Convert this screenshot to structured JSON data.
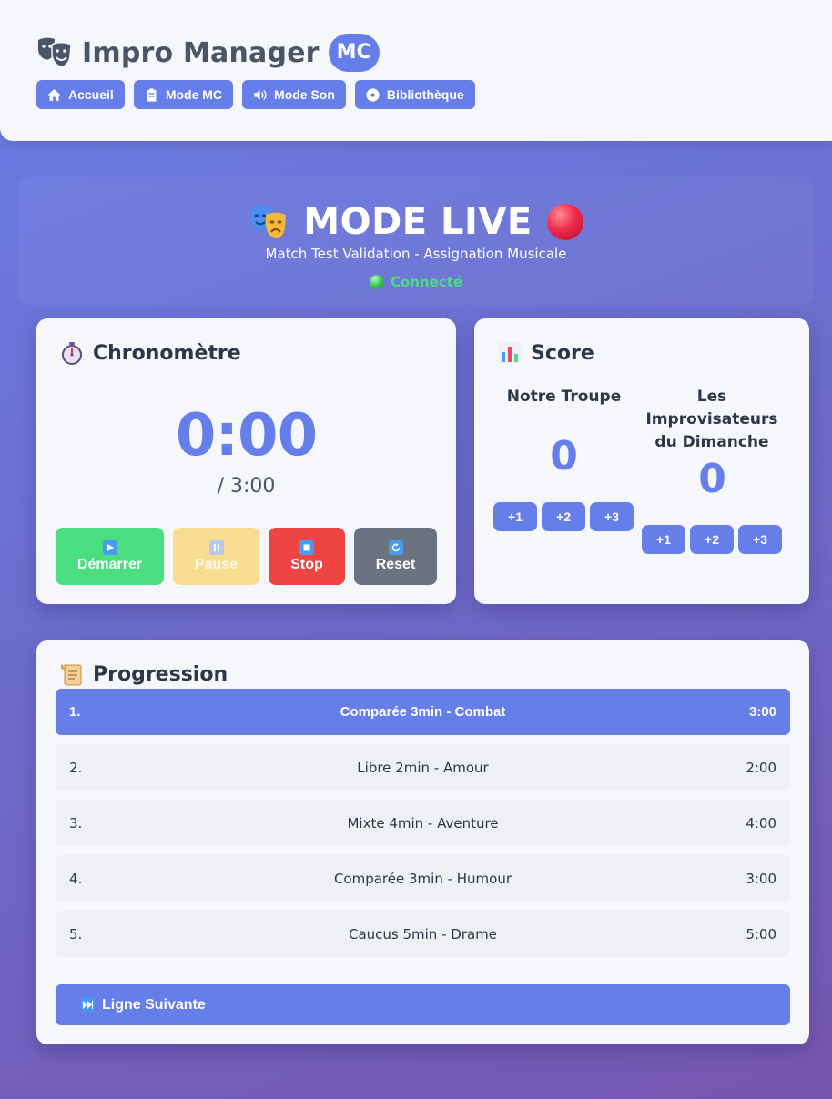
{
  "header": {
    "app_title": "Impro Manager",
    "badge": "MC",
    "nav": [
      {
        "label": "Accueil",
        "icon": "home-icon"
      },
      {
        "label": "Mode MC",
        "icon": "clipboard-icon"
      },
      {
        "label": "Mode Son",
        "icon": "speaker-icon"
      },
      {
        "label": "Bibliothèque",
        "icon": "disc-icon"
      }
    ]
  },
  "live": {
    "title": "MODE LIVE",
    "subtitle": "Match Test Validation - Assignation Musicale",
    "status": "Connecté"
  },
  "chrono": {
    "title": "Chronomètre",
    "elapsed": "0:00",
    "total": "/ 3:00",
    "buttons": {
      "start": "Démarrer",
      "pause": "Pause",
      "stop": "Stop",
      "reset": "Reset"
    }
  },
  "score": {
    "title": "Score",
    "teams": [
      {
        "name": "Notre Troupe",
        "score": "0"
      },
      {
        "name": "Les Improvisateurs du Dimanche",
        "score": "0"
      }
    ],
    "increments": [
      "+1",
      "+2",
      "+3"
    ]
  },
  "progression": {
    "title": "Progression",
    "rows": [
      {
        "num": "1.",
        "name": "Comparée 3min - Combat",
        "duration": "3:00",
        "active": true
      },
      {
        "num": "2.",
        "name": "Libre 2min - Amour",
        "duration": "2:00",
        "active": false
      },
      {
        "num": "3.",
        "name": "Mixte 4min - Aventure",
        "duration": "4:00",
        "active": false
      },
      {
        "num": "4.",
        "name": "Comparée 3min - Humour",
        "duration": "3:00",
        "active": false
      },
      {
        "num": "5.",
        "name": "Caucus 5min - Drame",
        "duration": "5:00",
        "active": false
      }
    ],
    "next_label": "Ligne Suivante"
  },
  "colors": {
    "accent": "#667eea",
    "start": "#4ade80",
    "pause": "#f8dc8f",
    "stop": "#ef4444",
    "reset": "#6b7280",
    "connected": "#4ade80"
  }
}
